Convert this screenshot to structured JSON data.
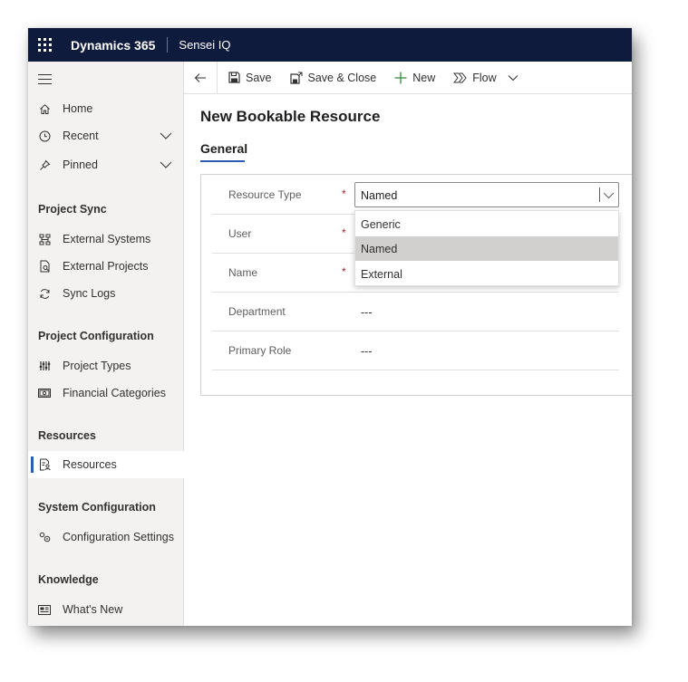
{
  "header": {
    "app_name": "Dynamics 365",
    "environment": "Sensei IQ"
  },
  "sidebar": {
    "top_items": [
      {
        "label": "Home",
        "icon": "home-icon"
      },
      {
        "label": "Recent",
        "icon": "clock-icon"
      },
      {
        "label": "Pinned",
        "icon": "pin-icon"
      }
    ],
    "sections": [
      {
        "title": "Project Sync",
        "items": [
          {
            "label": "External Systems",
            "icon": "hierarchy-icon"
          },
          {
            "label": "External Projects",
            "icon": "document-search-icon"
          },
          {
            "label": "Sync Logs",
            "icon": "sync-icon"
          }
        ]
      },
      {
        "title": "Project Configuration",
        "items": [
          {
            "label": "Project Types",
            "icon": "sliders-icon"
          },
          {
            "label": "Financial Categories",
            "icon": "money-icon"
          }
        ]
      },
      {
        "title": "Resources",
        "items": [
          {
            "label": "Resources",
            "icon": "resource-icon",
            "selected": true
          }
        ]
      },
      {
        "title": "System Configuration",
        "items": [
          {
            "label": "Configuration Settings",
            "icon": "settings-icon"
          }
        ]
      },
      {
        "title": "Knowledge",
        "items": [
          {
            "label": "What's New",
            "icon": "news-icon"
          }
        ]
      }
    ]
  },
  "commands": {
    "save": "Save",
    "save_close": "Save & Close",
    "new": "New",
    "flow": "Flow"
  },
  "form": {
    "title": "New Bookable Resource",
    "tab": "General",
    "fields": [
      {
        "label": "Resource Type",
        "value": "Named",
        "required": true
      },
      {
        "label": "User",
        "value": "",
        "required": true
      },
      {
        "label": "Name",
        "value": "",
        "required": true
      },
      {
        "label": "Department",
        "value": "---",
        "required": false
      },
      {
        "label": "Primary Role",
        "value": "---",
        "required": false
      }
    ],
    "required_marker": "*",
    "dropdown_options": [
      "Generic",
      "Named",
      "External"
    ],
    "dropdown_selected": "Named"
  },
  "colors": {
    "topbar": "#0f1b3d",
    "accent": "#2b5bb5",
    "required": "#a4262c"
  }
}
